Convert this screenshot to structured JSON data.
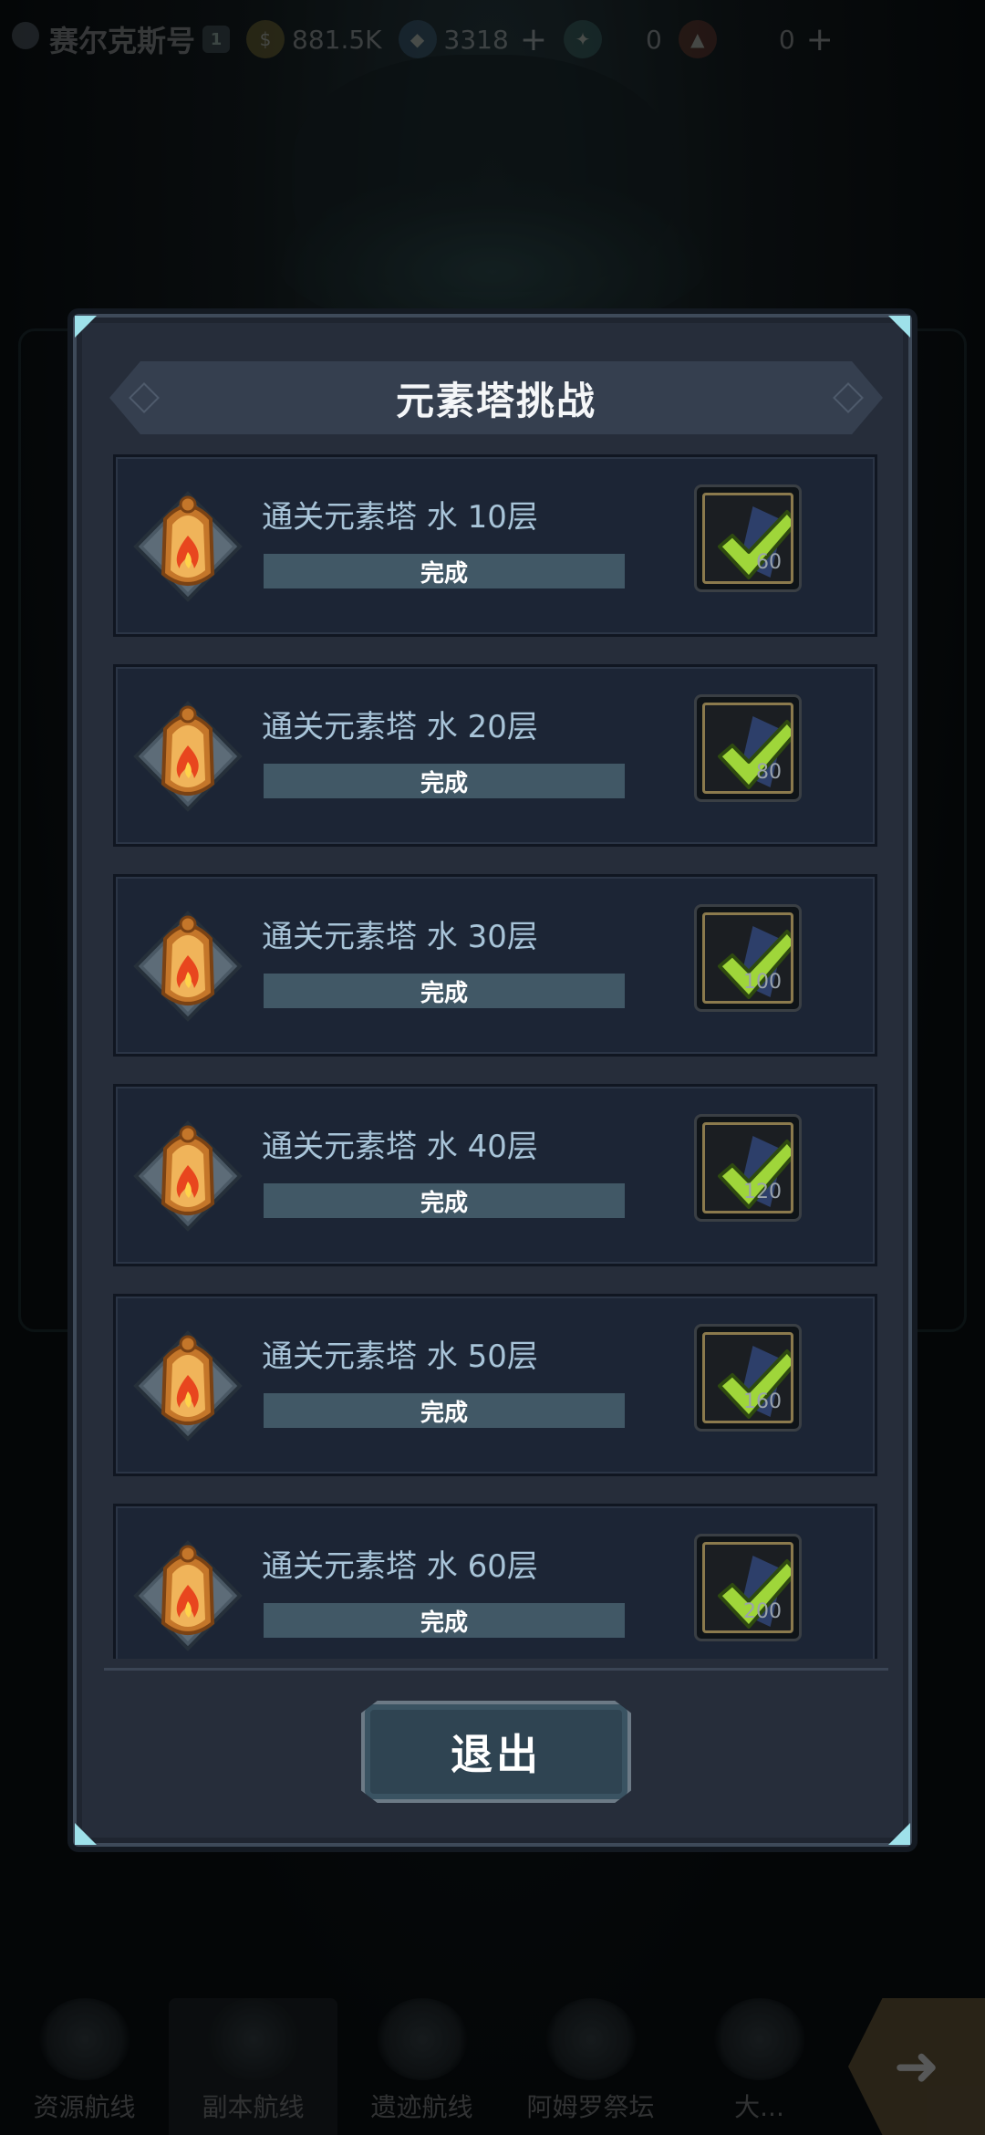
{
  "topbar": {
    "player_name": "赛尔克斯号",
    "level": "1",
    "gold": "881.5K",
    "gems": "3318",
    "res3": "0",
    "res4": "0"
  },
  "bottom_nav": [
    {
      "label": "资源航线"
    },
    {
      "label": "副本航线"
    },
    {
      "label": "遗迹航线"
    },
    {
      "label": "阿姆罗祭坛"
    },
    {
      "label": "大..."
    }
  ],
  "dialog": {
    "title": "元素塔挑战",
    "exit_label": "退出",
    "tasks": [
      {
        "title": "通关元素塔 水 10层",
        "status": "完成",
        "reward_amount": "60"
      },
      {
        "title": "通关元素塔 水 20层",
        "status": "完成",
        "reward_amount": "80"
      },
      {
        "title": "通关元素塔 水 30层",
        "status": "完成",
        "reward_amount": "100"
      },
      {
        "title": "通关元素塔 水 40层",
        "status": "完成",
        "reward_amount": "120"
      },
      {
        "title": "通关元素塔 水 50层",
        "status": "完成",
        "reward_amount": "160"
      },
      {
        "title": "通关元素塔 水 60层",
        "status": "完成",
        "reward_amount": "200"
      }
    ]
  },
  "colors": {
    "accent_check": "#9fd63a",
    "dialog_bg": "#262d3a",
    "row_bg": "#1c2535",
    "progress_fill": "#415866",
    "title_text": "#a8c4d8"
  },
  "icons": {
    "task_badge": "fire-badge-icon",
    "reward": "gem-check-icon"
  }
}
